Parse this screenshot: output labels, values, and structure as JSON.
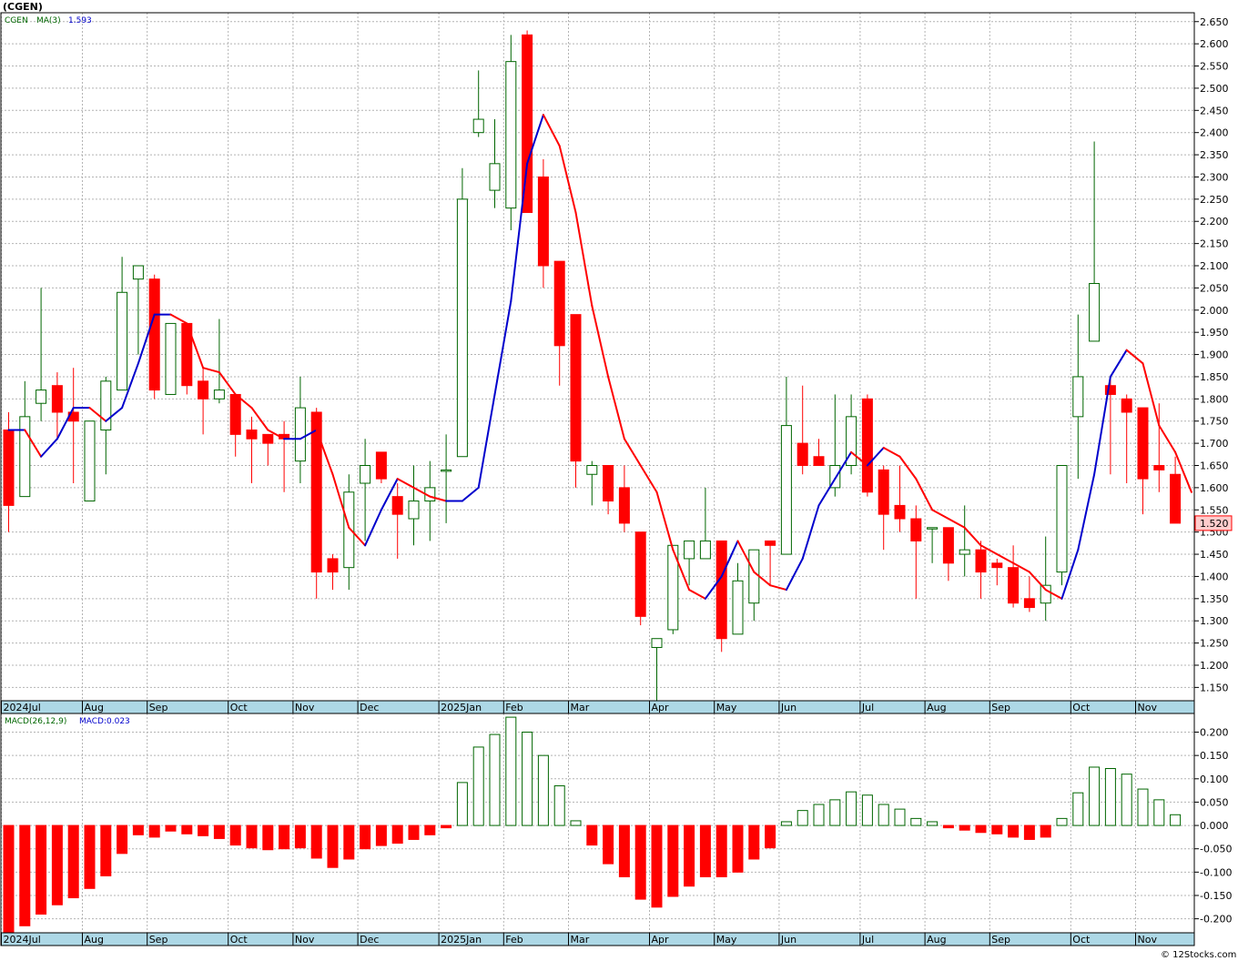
{
  "title": "(CGEN)",
  "price_panel": {
    "symbol_label": "CGEN",
    "ma_label": "MA(3)",
    "ma_value": "1.593",
    "last_price": "1.520"
  },
  "macd_panel": {
    "label": "MACD(26,12,9)",
    "value_label": "MACD:0.023"
  },
  "footer": "© 12Stocks.com",
  "colors": {
    "up": "#006600",
    "down": "#ff0000",
    "ma_up": "#0000cc",
    "ma_down": "#ff0000",
    "grid": "#b4b4b4",
    "axis_band": "#add8e6",
    "price_tag": "#ffcccc"
  },
  "chart_data": [
    {
      "type": "candlestick",
      "ylim": [
        1.12,
        2.67
      ],
      "yticks": [
        1.15,
        1.2,
        1.25,
        1.3,
        1.35,
        1.4,
        1.45,
        1.5,
        1.55,
        1.6,
        1.65,
        1.7,
        1.75,
        1.8,
        1.85,
        1.9,
        1.95,
        2.0,
        2.05,
        2.1,
        2.15,
        2.2,
        2.25,
        2.3,
        2.35,
        2.4,
        2.45,
        2.5,
        2.55,
        2.6,
        2.65
      ],
      "x_labels": [
        {
          "i": 0,
          "label": "2024Jul"
        },
        {
          "i": 5,
          "label": "Aug"
        },
        {
          "i": 9,
          "label": "Sep"
        },
        {
          "i": 14,
          "label": "Oct"
        },
        {
          "i": 18,
          "label": "Nov"
        },
        {
          "i": 22,
          "label": "Dec"
        },
        {
          "i": 27,
          "label": "2025Jan"
        },
        {
          "i": 31,
          "label": "Feb"
        },
        {
          "i": 35,
          "label": "Mar"
        },
        {
          "i": 40,
          "label": "Apr"
        },
        {
          "i": 44,
          "label": "May"
        },
        {
          "i": 48,
          "label": "Jun"
        },
        {
          "i": 53,
          "label": "Jul"
        },
        {
          "i": 57,
          "label": "Aug"
        },
        {
          "i": 61,
          "label": "Sep"
        },
        {
          "i": 66,
          "label": "Oct"
        },
        {
          "i": 70,
          "label": "Nov"
        }
      ],
      "candles": [
        {
          "o": 1.73,
          "h": 1.77,
          "l": 1.5,
          "c": 1.56
        },
        {
          "o": 1.58,
          "h": 1.84,
          "l": 1.58,
          "c": 1.76
        },
        {
          "o": 1.79,
          "h": 2.05,
          "l": 1.75,
          "c": 1.82
        },
        {
          "o": 1.83,
          "h": 1.86,
          "l": 1.71,
          "c": 1.77
        },
        {
          "o": 1.77,
          "h": 1.87,
          "l": 1.61,
          "c": 1.75
        },
        {
          "o": 1.57,
          "h": 1.75,
          "l": 1.57,
          "c": 1.75
        },
        {
          "o": 1.73,
          "h": 1.85,
          "l": 1.63,
          "c": 1.84
        },
        {
          "o": 1.82,
          "h": 2.12,
          "l": 1.82,
          "c": 2.04
        },
        {
          "o": 2.07,
          "h": 2.1,
          "l": 1.9,
          "c": 2.1
        },
        {
          "o": 2.07,
          "h": 2.08,
          "l": 1.8,
          "c": 1.82
        },
        {
          "o": 1.81,
          "h": 1.97,
          "l": 1.81,
          "c": 1.97
        },
        {
          "o": 1.97,
          "h": 1.97,
          "l": 1.81,
          "c": 1.83
        },
        {
          "o": 1.84,
          "h": 1.87,
          "l": 1.72,
          "c": 1.8
        },
        {
          "o": 1.8,
          "h": 1.98,
          "l": 1.79,
          "c": 1.82
        },
        {
          "o": 1.81,
          "h": 1.81,
          "l": 1.67,
          "c": 1.72
        },
        {
          "o": 1.73,
          "h": 1.76,
          "l": 1.61,
          "c": 1.71
        },
        {
          "o": 1.72,
          "h": 1.72,
          "l": 1.65,
          "c": 1.7
        },
        {
          "o": 1.72,
          "h": 1.75,
          "l": 1.59,
          "c": 1.71
        },
        {
          "o": 1.66,
          "h": 1.85,
          "l": 1.61,
          "c": 1.78
        },
        {
          "o": 1.77,
          "h": 1.78,
          "l": 1.35,
          "c": 1.41
        },
        {
          "o": 1.44,
          "h": 1.45,
          "l": 1.37,
          "c": 1.41
        },
        {
          "o": 1.42,
          "h": 1.63,
          "l": 1.37,
          "c": 1.59
        },
        {
          "o": 1.61,
          "h": 1.71,
          "l": 1.48,
          "c": 1.65
        },
        {
          "o": 1.68,
          "h": 1.68,
          "l": 1.61,
          "c": 1.62
        },
        {
          "o": 1.58,
          "h": 1.61,
          "l": 1.44,
          "c": 1.54
        },
        {
          "o": 1.53,
          "h": 1.65,
          "l": 1.47,
          "c": 1.57
        },
        {
          "o": 1.57,
          "h": 1.66,
          "l": 1.48,
          "c": 1.6
        },
        {
          "o": 1.64,
          "h": 1.72,
          "l": 1.52,
          "c": 1.64
        },
        {
          "o": 1.67,
          "h": 2.32,
          "l": 1.67,
          "c": 2.25
        },
        {
          "o": 2.4,
          "h": 2.54,
          "l": 2.39,
          "c": 2.43
        },
        {
          "o": 2.27,
          "h": 2.43,
          "l": 2.23,
          "c": 2.33
        },
        {
          "o": 2.23,
          "h": 2.62,
          "l": 2.18,
          "c": 2.56
        },
        {
          "o": 2.62,
          "h": 2.63,
          "l": 2.22,
          "c": 2.22
        },
        {
          "o": 2.3,
          "h": 2.34,
          "l": 2.05,
          "c": 2.1
        },
        {
          "o": 2.11,
          "h": 2.11,
          "l": 1.83,
          "c": 1.92
        },
        {
          "o": 1.99,
          "h": 1.99,
          "l": 1.6,
          "c": 1.66
        },
        {
          "o": 1.63,
          "h": 1.66,
          "l": 1.56,
          "c": 1.65
        },
        {
          "o": 1.65,
          "h": 1.65,
          "l": 1.54,
          "c": 1.57
        },
        {
          "o": 1.6,
          "h": 1.65,
          "l": 1.5,
          "c": 1.52
        },
        {
          "o": 1.5,
          "h": 1.5,
          "l": 1.29,
          "c": 1.31
        },
        {
          "o": 1.24,
          "h": 1.26,
          "l": 1.12,
          "c": 1.26
        },
        {
          "o": 1.28,
          "h": 1.47,
          "l": 1.27,
          "c": 1.47
        },
        {
          "o": 1.44,
          "h": 1.48,
          "l": 1.38,
          "c": 1.48
        },
        {
          "o": 1.44,
          "h": 1.6,
          "l": 1.44,
          "c": 1.48
        },
        {
          "o": 1.48,
          "h": 1.48,
          "l": 1.23,
          "c": 1.26
        },
        {
          "o": 1.27,
          "h": 1.43,
          "l": 1.27,
          "c": 1.39
        },
        {
          "o": 1.34,
          "h": 1.46,
          "l": 1.3,
          "c": 1.46
        },
        {
          "o": 1.48,
          "h": 1.48,
          "l": 1.38,
          "c": 1.47
        },
        {
          "o": 1.45,
          "h": 1.85,
          "l": 1.45,
          "c": 1.74
        },
        {
          "o": 1.7,
          "h": 1.83,
          "l": 1.63,
          "c": 1.65
        },
        {
          "o": 1.67,
          "h": 1.71,
          "l": 1.65,
          "c": 1.65
        },
        {
          "o": 1.6,
          "h": 1.81,
          "l": 1.58,
          "c": 1.65
        },
        {
          "o": 1.65,
          "h": 1.81,
          "l": 1.63,
          "c": 1.76
        },
        {
          "o": 1.8,
          "h": 1.81,
          "l": 1.58,
          "c": 1.59
        },
        {
          "o": 1.64,
          "h": 1.65,
          "l": 1.46,
          "c": 1.54
        },
        {
          "o": 1.56,
          "h": 1.65,
          "l": 1.5,
          "c": 1.53
        },
        {
          "o": 1.53,
          "h": 1.56,
          "l": 1.35,
          "c": 1.48
        },
        {
          "o": 1.51,
          "h": 1.51,
          "l": 1.43,
          "c": 1.51
        },
        {
          "o": 1.51,
          "h": 1.51,
          "l": 1.39,
          "c": 1.43
        },
        {
          "o": 1.45,
          "h": 1.56,
          "l": 1.4,
          "c": 1.46
        },
        {
          "o": 1.46,
          "h": 1.48,
          "l": 1.35,
          "c": 1.41
        },
        {
          "o": 1.43,
          "h": 1.44,
          "l": 1.38,
          "c": 1.42
        },
        {
          "o": 1.42,
          "h": 1.47,
          "l": 1.33,
          "c": 1.34
        },
        {
          "o": 1.35,
          "h": 1.4,
          "l": 1.32,
          "c": 1.33
        },
        {
          "o": 1.34,
          "h": 1.49,
          "l": 1.3,
          "c": 1.38
        },
        {
          "o": 1.41,
          "h": 1.65,
          "l": 1.38,
          "c": 1.65
        },
        {
          "o": 1.76,
          "h": 1.99,
          "l": 1.62,
          "c": 1.85
        },
        {
          "o": 1.93,
          "h": 2.38,
          "l": 1.93,
          "c": 2.06
        },
        {
          "o": 1.83,
          "h": 1.85,
          "l": 1.63,
          "c": 1.81
        },
        {
          "o": 1.8,
          "h": 1.81,
          "l": 1.61,
          "c": 1.77
        },
        {
          "o": 1.78,
          "h": 1.78,
          "l": 1.54,
          "c": 1.62
        },
        {
          "o": 1.65,
          "h": 1.79,
          "l": 1.59,
          "c": 1.64
        },
        {
          "o": 1.63,
          "h": 1.67,
          "l": 1.52,
          "c": 1.52
        }
      ],
      "ma": [
        1.73,
        1.73,
        1.67,
        1.71,
        1.78,
        1.78,
        1.75,
        1.78,
        1.88,
        1.99,
        1.99,
        1.97,
        1.87,
        1.86,
        1.81,
        1.78,
        1.73,
        1.71,
        1.71,
        1.73,
        1.63,
        1.51,
        1.47,
        1.55,
        1.62,
        1.6,
        1.58,
        1.57,
        1.57,
        1.6,
        1.81,
        2.02,
        2.33,
        2.44,
        2.37,
        2.22,
        2.01,
        1.85,
        1.71,
        1.65,
        1.59,
        1.46,
        1.37,
        1.35,
        1.4,
        1.48,
        1.41,
        1.38,
        1.37,
        1.44,
        1.56,
        1.62,
        1.68,
        1.65,
        1.69,
        1.67,
        1.62,
        1.55,
        1.53,
        1.51,
        1.47,
        1.45,
        1.43,
        1.41,
        1.37,
        1.35,
        1.46,
        1.63,
        1.85,
        1.91,
        1.88,
        1.74,
        1.68,
        1.59
      ],
      "ma_last": 1.593
    },
    {
      "type": "bar",
      "name": "MACD(26,12,9)",
      "ylim": [
        -0.23,
        0.24
      ],
      "yticks": [
        -0.2,
        -0.15,
        -0.1,
        -0.05,
        0.0,
        0.05,
        0.1,
        0.15,
        0.2
      ],
      "x_labels": [
        {
          "i": 0,
          "label": "2024Jul"
        },
        {
          "i": 5,
          "label": "Aug"
        },
        {
          "i": 9,
          "label": "Sep"
        },
        {
          "i": 14,
          "label": "Oct"
        },
        {
          "i": 18,
          "label": "Nov"
        },
        {
          "i": 22,
          "label": "Dec"
        },
        {
          "i": 27,
          "label": "2025Jan"
        },
        {
          "i": 31,
          "label": "Feb"
        },
        {
          "i": 35,
          "label": "Mar"
        },
        {
          "i": 40,
          "label": "Apr"
        },
        {
          "i": 44,
          "label": "May"
        },
        {
          "i": 48,
          "label": "Jun"
        },
        {
          "i": 53,
          "label": "Jul"
        },
        {
          "i": 57,
          "label": "Aug"
        },
        {
          "i": 61,
          "label": "Sep"
        },
        {
          "i": 66,
          "label": "Oct"
        },
        {
          "i": 70,
          "label": "Nov"
        }
      ],
      "values": [
        -0.23,
        -0.215,
        -0.19,
        -0.17,
        -0.155,
        -0.135,
        -0.108,
        -0.06,
        -0.02,
        -0.025,
        -0.012,
        -0.018,
        -0.022,
        -0.028,
        -0.042,
        -0.048,
        -0.052,
        -0.05,
        -0.048,
        -0.07,
        -0.09,
        -0.072,
        -0.05,
        -0.043,
        -0.038,
        -0.03,
        -0.02,
        -0.005,
        0.092,
        0.168,
        0.195,
        0.232,
        0.2,
        0.15,
        0.085,
        0.01,
        -0.042,
        -0.082,
        -0.11,
        -0.158,
        -0.175,
        -0.152,
        -0.13,
        -0.11,
        -0.11,
        -0.1,
        -0.072,
        -0.048,
        0.008,
        0.032,
        0.045,
        0.055,
        0.072,
        0.065,
        0.045,
        0.035,
        0.015,
        0.008,
        -0.005,
        -0.01,
        -0.015,
        -0.018,
        -0.025,
        -0.03,
        -0.025,
        0.015,
        0.07,
        0.125,
        0.122,
        0.11,
        0.078,
        0.055,
        0.023
      ]
    }
  ]
}
